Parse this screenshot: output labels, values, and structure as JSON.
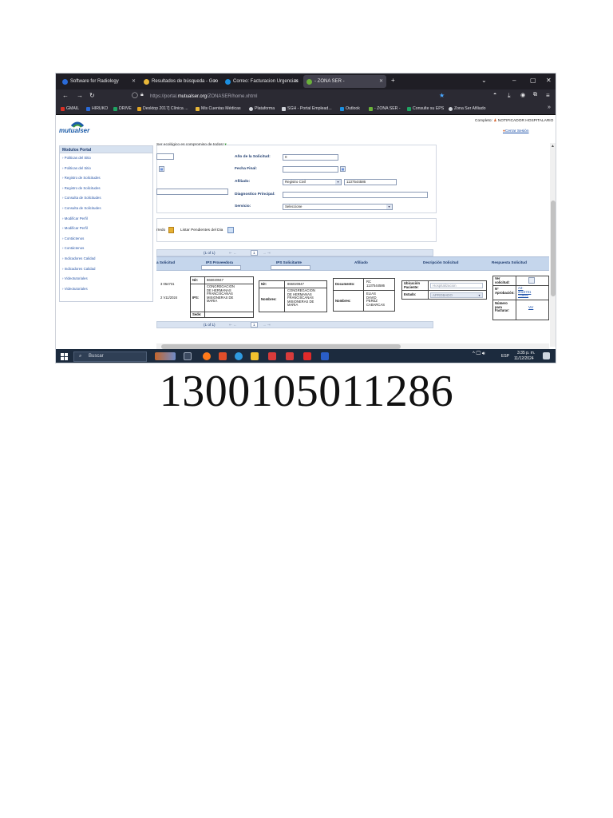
{
  "browser": {
    "tabs": [
      {
        "label": "Software for Radiology"
      },
      {
        "label": "Resultados de búsqueda - Goo"
      },
      {
        "label": "Correo: Facturacion Urgencias"
      },
      {
        "label": "- ZONA SER -"
      }
    ],
    "new_tab": "+",
    "url_prefix": "https://portal.",
    "url_domain": "mutualser.org",
    "url_suffix": "/ZONASER/home.xhtml",
    "bookmarks": [
      "GMAIL",
      "HIRUKO",
      "DRIVE",
      "Desktop 2017] Clínica ...",
      "Mis Cuentas Médicas",
      "Plataforma",
      "SGH - Portal Emplead...",
      "Outlook",
      "- ZONA SER -",
      "Consulte su EPS",
      "Zona Ser Afiliado"
    ]
  },
  "header": {
    "logo_text": "mutualser",
    "user_label": "Completo:",
    "user_name": "NOTIFICADOR HOSPITALARIO",
    "logout": "Cerrar Sesión"
  },
  "left_menu": {
    "title": "Modulos Portal",
    "items": [
      "Politicas del Sitio",
      "Politicas del Sitio",
      "Registro de Solicitudes",
      "Registro de Solicitudes",
      "Consulta de Solicitudes",
      "Consulta de Solicitudes",
      "Modificar Perfil",
      "Modificar Perfil",
      "Contáctenos",
      "Contáctenos",
      "Indicadores Calidad",
      "Indicadores Calidad",
      "Videotutoriales",
      "Videotutoriales"
    ]
  },
  "form": {
    "eco_message": "Ser ecológico es compromiso de todos!",
    "anio_label": "Año de la Solicitud:",
    "anio_value": "0",
    "fecha_label": "Fecha Final:",
    "afiliado_label": "Afiliado:",
    "doc_type": "Registro Civil",
    "doc_number": "1137544586",
    "diag_label": "Diagnostico Principal:",
    "servicio_label": "Servicio:",
    "servicio_value": "Seleccione",
    "cal_icon": "calendar-icon"
  },
  "actions": {
    "partial_label": "rredo",
    "list_label": "Listar Pendientes del Dia"
  },
  "pager": {
    "label": "(1 of 1)",
    "page": "1"
  },
  "table": {
    "headers": [
      "a Solicitud",
      "IPS Proveedora",
      "IPS Solicitante",
      "Afiliado",
      "Decripción Solicitud",
      "Respuesta Solicitud"
    ],
    "row": {
      "num1": "3 054731",
      "date1": "2 V11/2024",
      "prov_nit_label": "Nit:",
      "prov_nit": "866020947",
      "prov_ips_label": "IPS:",
      "prov_ips": [
        "CONGREGACION",
        "DE HERMANAS",
        "FRANCISCANAS",
        "MISIONERAS DE",
        "MARIA"
      ],
      "prov_sede_label": "Sede:",
      "sol_nit_label": "Nit:",
      "sol_nit": "866020947",
      "sol_nom_label": "Nombres:",
      "sol_nom": [
        "CONGREGACION",
        "DE HERMANAS",
        "FRANCISCANAS",
        "MISIONERAS DE",
        "MARIA"
      ],
      "af_doc_label": "Documento:",
      "af_doc": [
        "RC",
        "1137544586"
      ],
      "af_nom_label": "Nombres:",
      "af_nom": [
        "ELIAS",
        "DAVID",
        "PEREZ",
        "CABARCAS"
      ],
      "ubic_label": [
        "Ubicación",
        "Paciente:"
      ],
      "ubic_value": "Hospitalizacion",
      "estado_label": "Estado:",
      "estado_value": "APROBADO",
      "ver_label": [
        "Ver",
        "solicitud:"
      ],
      "no_aprob_label": [
        "N°",
        "Aprobación:"
      ],
      "no_aprob_value": [
        "A3-",
        "2024731",
        "-13891"
      ],
      "num_fact_label": [
        "Número",
        "para",
        "Facturar:"
      ],
      "ver_link": "Ver"
    }
  },
  "taskbar": {
    "search": "Buscar",
    "lang": "ESP",
    "time": "3:35 p. m.",
    "date": "11/12/2024"
  },
  "document_number": "1300105011286"
}
